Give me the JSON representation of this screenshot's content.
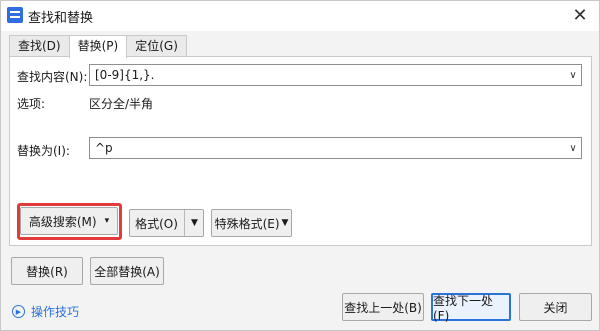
{
  "window": {
    "title": "查找和替换",
    "close_glyph": "✕"
  },
  "tabs": [
    {
      "label": "查找(D)",
      "active": false
    },
    {
      "label": "替换(P)",
      "active": true
    },
    {
      "label": "定位(G)",
      "active": false
    }
  ],
  "find": {
    "label": "查找内容(N):",
    "value": "[0-9]{1,}."
  },
  "options": {
    "label": "选项:",
    "value": "区分全/半角"
  },
  "replace": {
    "label": "替换为(I):",
    "value": "^p"
  },
  "panel_buttons": {
    "advanced": "高级搜索(M)",
    "format": "格式(O)",
    "special": "特殊格式(E)"
  },
  "actions": {
    "replace": "替换(R)",
    "replace_all": "全部替换(A)",
    "find_prev": "查找上一处(B)",
    "find_next": "查找下一处(F)",
    "close": "关闭"
  },
  "tips": {
    "label": "操作技巧"
  },
  "colors": {
    "accent": "#2a73d9",
    "highlight": "#e13b3b"
  }
}
